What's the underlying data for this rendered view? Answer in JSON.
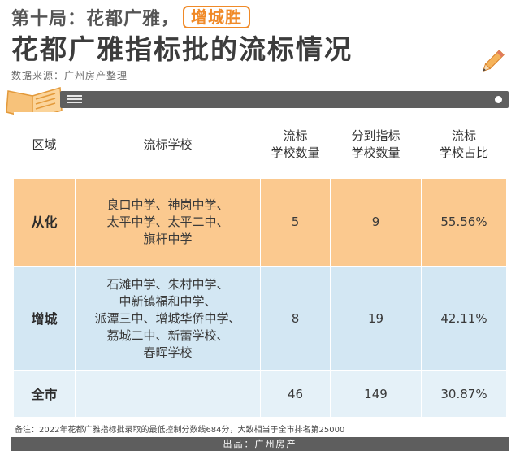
{
  "header": {
    "round": "第十局：花都广雅，",
    "winner": "增城胜",
    "title": "花都广雅指标批的流标情况",
    "source": "数据来源：广州房产整理"
  },
  "table": {
    "headers": [
      "区域",
      "流标学校",
      "流标\n学校数量",
      "分到指标\n学校数量",
      "流标\n学校占比"
    ],
    "rows": [
      {
        "region": "从化",
        "schools": "良口中学、神岗中学、\n太平中学、太平二中、\n旗杆中学",
        "count": "5",
        "assigned": "9",
        "ratio": "55.56%"
      },
      {
        "region": "增城",
        "schools": "石滩中学、朱村中学、\n中新镇福和中学、\n派潭三中、增城华侨中学、\n荔城二中、新蕾学校、\n春晖学校",
        "count": "8",
        "assigned": "19",
        "ratio": "42.11%"
      },
      {
        "region": "全市",
        "schools": "",
        "count": "46",
        "assigned": "149",
        "ratio": "30.87%"
      }
    ]
  },
  "note": "备注：2022年花都广雅指标批录取的最低控制分数线684分，大致相当于全市排名第25000",
  "footer": "出品：广州房产",
  "colors": {
    "accent": "#f08a28",
    "row_conghua": "#fbc98f",
    "row_zengcheng": "#d3e7f3",
    "row_city": "#e5f1f8",
    "bar": "#5e5e5e"
  },
  "icons": [
    "pencil-icon",
    "book-icon",
    "menu-icon",
    "dot-icon"
  ]
}
